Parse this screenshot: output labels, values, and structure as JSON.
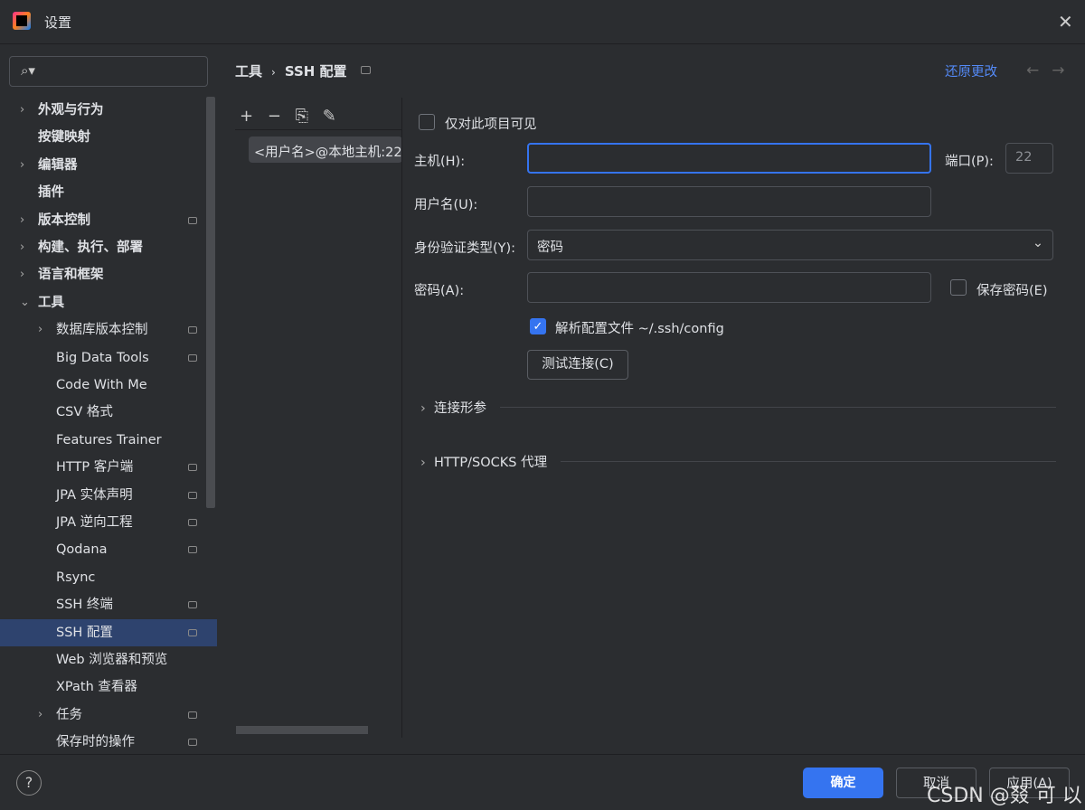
{
  "window": {
    "title": "设置"
  },
  "sidebar": {
    "items": [
      {
        "label": "外观与行为",
        "expandable": true,
        "bold": true,
        "level": 0
      },
      {
        "label": "按键映射",
        "expandable": false,
        "bold": true,
        "level": 0
      },
      {
        "label": "编辑器",
        "expandable": true,
        "bold": true,
        "level": 0
      },
      {
        "label": "插件",
        "expandable": false,
        "bold": true,
        "level": 0
      },
      {
        "label": "版本控制",
        "expandable": true,
        "bold": true,
        "level": 0,
        "project": true
      },
      {
        "label": "构建、执行、部署",
        "expandable": true,
        "bold": true,
        "level": 0
      },
      {
        "label": "语言和框架",
        "expandable": true,
        "bold": true,
        "level": 0
      },
      {
        "label": "工具",
        "expandable": true,
        "expanded": true,
        "bold": true,
        "level": 0
      },
      {
        "label": "数据库版本控制",
        "expandable": true,
        "level": 1,
        "project": true
      },
      {
        "label": "Big Data Tools",
        "level": 1,
        "project": true
      },
      {
        "label": "Code With Me",
        "level": 1
      },
      {
        "label": "CSV 格式",
        "level": 1
      },
      {
        "label": "Features Trainer",
        "level": 1
      },
      {
        "label": "HTTP 客户端",
        "level": 1,
        "project": true
      },
      {
        "label": "JPA 实体声明",
        "level": 1,
        "project": true
      },
      {
        "label": "JPA 逆向工程",
        "level": 1,
        "project": true
      },
      {
        "label": "Qodana",
        "level": 1,
        "project": true
      },
      {
        "label": "Rsync",
        "level": 1
      },
      {
        "label": "SSH 终端",
        "level": 1,
        "project": true
      },
      {
        "label": "SSH 配置",
        "level": 1,
        "project": true,
        "selected": true
      },
      {
        "label": "Web 浏览器和预览",
        "level": 1
      },
      {
        "label": "XPath 查看器",
        "level": 1
      },
      {
        "label": "任务",
        "expandable": true,
        "level": 1,
        "project": true
      },
      {
        "label": "保存时的操作",
        "level": 1,
        "project": true
      }
    ]
  },
  "breadcrumb": [
    "工具",
    "›",
    "SSH 配置"
  ],
  "header": {
    "reset": "还原更改"
  },
  "list": {
    "items": [
      "<用户名>@本地主机:22"
    ]
  },
  "form": {
    "project_only": "仅对此项目可见",
    "host_label": "主机(H):",
    "host_value": "",
    "port_label": "端口(P):",
    "port_value": "22",
    "user_label": "用户名(U):",
    "user_value": "",
    "auth_label": "身份验证类型(Y):",
    "auth_value": "密码",
    "password_label": "密码(A):",
    "password_value": "",
    "save_password": "保存密码(E)",
    "parse_config": "解析配置文件 ~/.ssh/config",
    "parse_config_checked": true,
    "test_button": "测试连接(C)",
    "section_connection": "连接形参",
    "section_proxy": "HTTP/SOCKS 代理"
  },
  "footer": {
    "help": "?",
    "ok": "确定",
    "cancel": "取消",
    "apply": "应用(A)"
  },
  "watermark": "CSDN @叕 可 以",
  "colors": {
    "accent": "#3574f0",
    "link": "#548af7",
    "selection": "#2e436e"
  }
}
